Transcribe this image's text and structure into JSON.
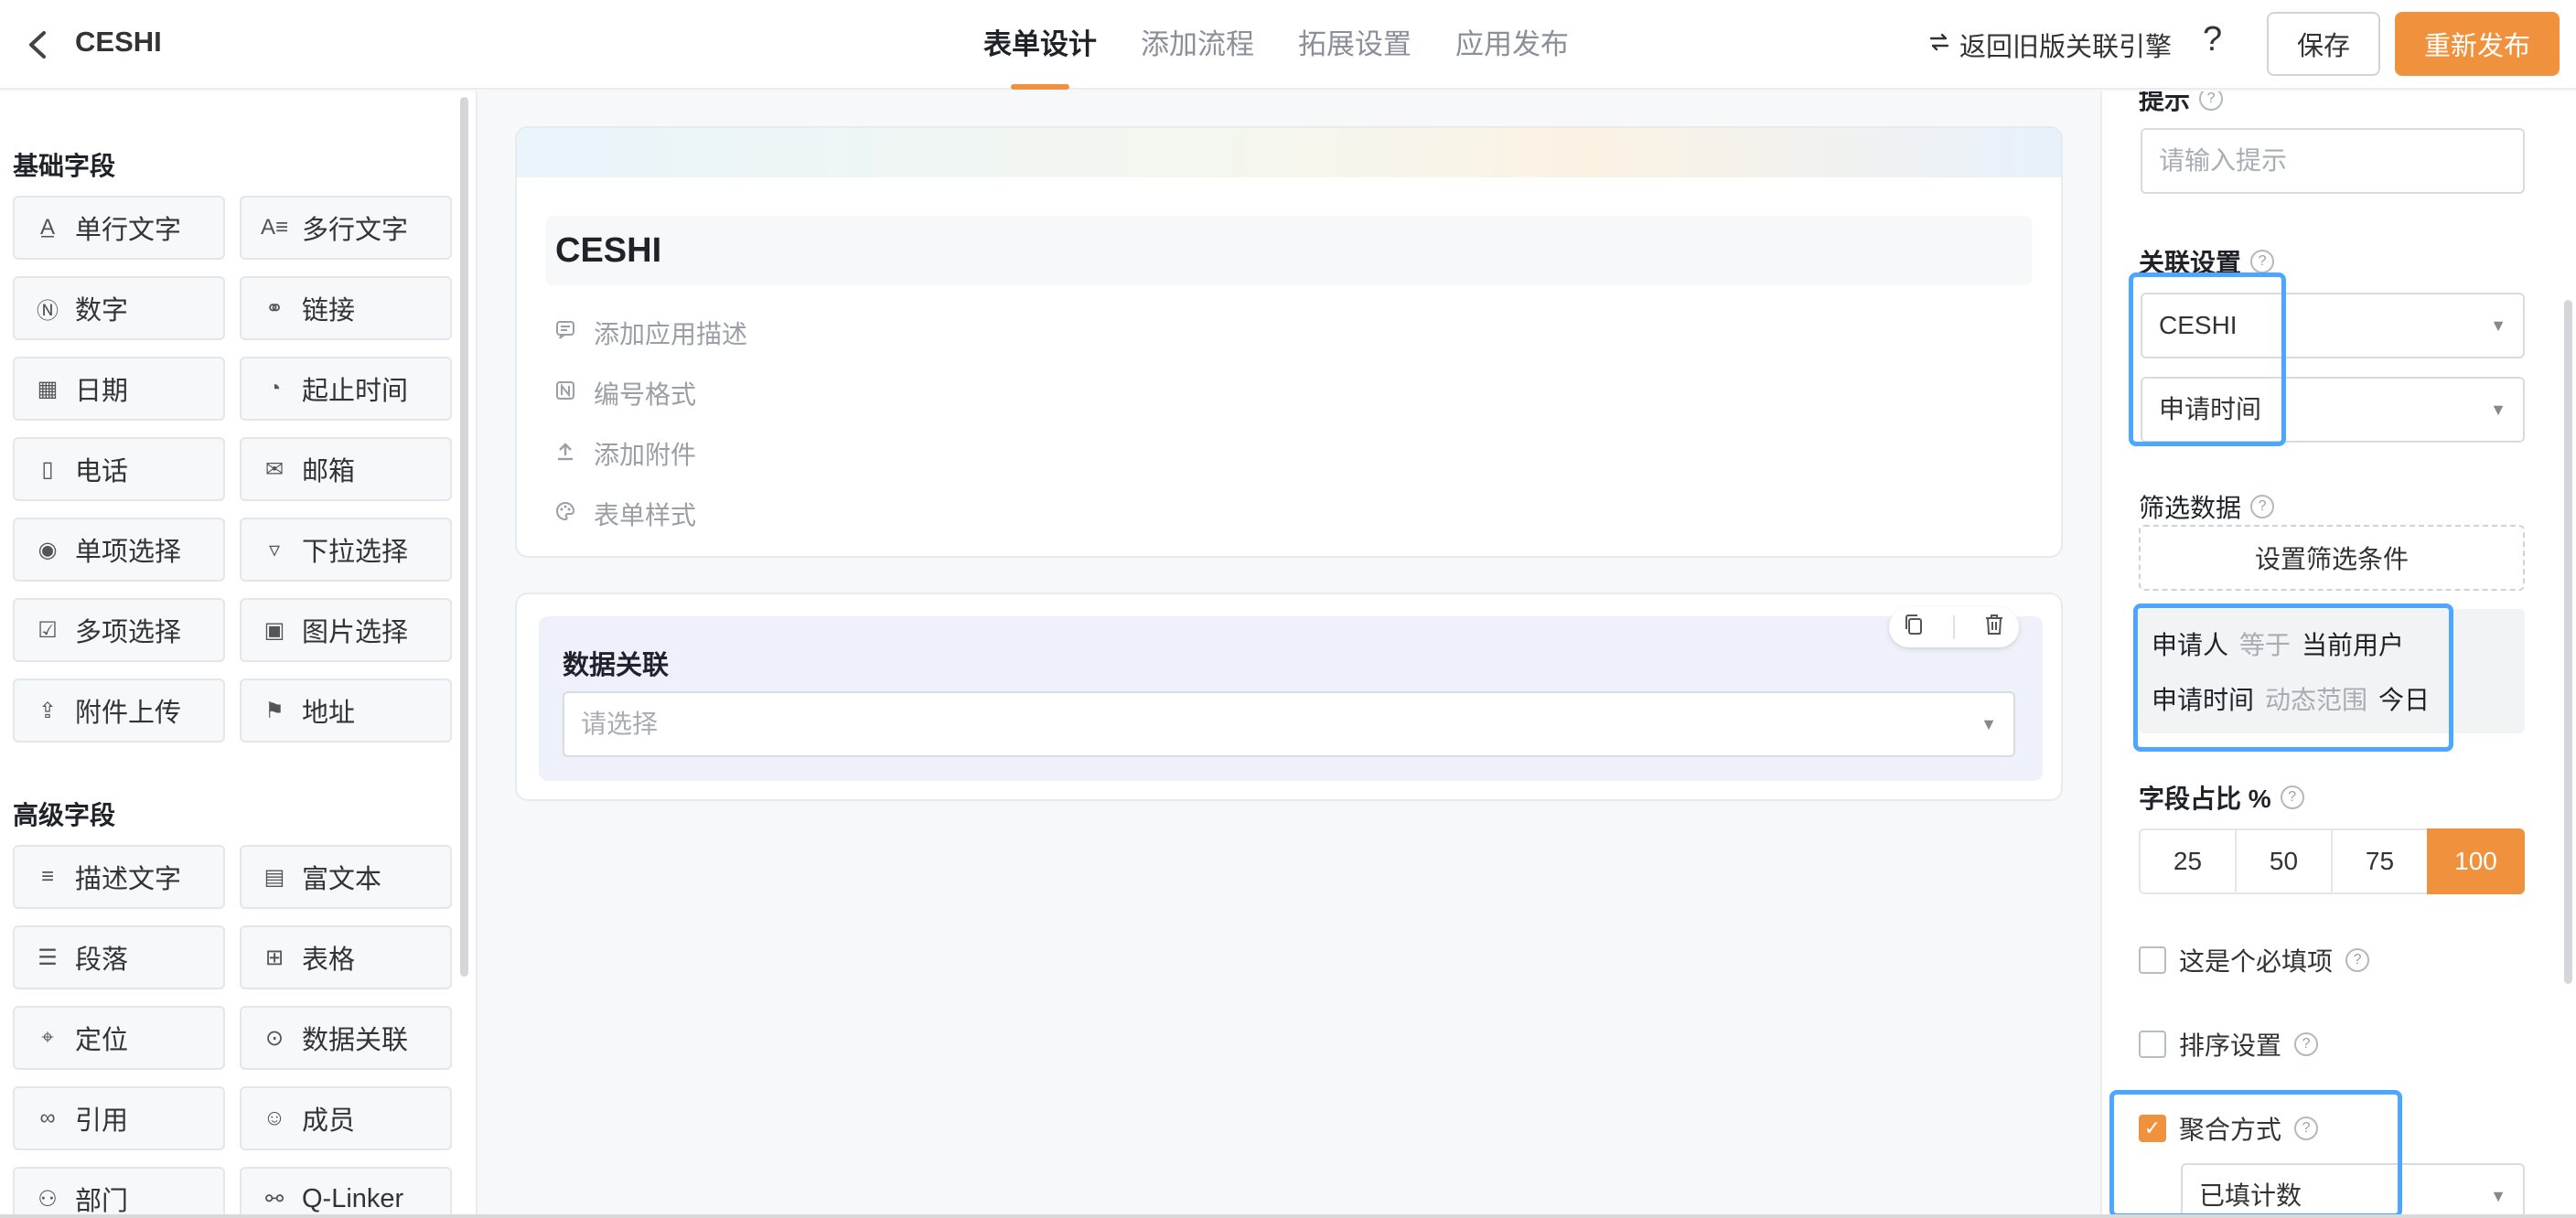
{
  "header": {
    "title": "CESHI",
    "tabs": [
      "表单设计",
      "添加流程",
      "拓展设置",
      "应用发布"
    ],
    "legacy_link": "返回旧版关联引擎",
    "save": "保存",
    "publish": "重新发布",
    "accent": "#f0923d"
  },
  "sidebar": {
    "basic_title": "基础字段",
    "basic": [
      {
        "label": "单行文字",
        "icon": "text-line-icon"
      },
      {
        "label": "多行文字",
        "icon": "text-multiline-icon"
      },
      {
        "label": "数字",
        "icon": "number-icon"
      },
      {
        "label": "链接",
        "icon": "link-icon"
      },
      {
        "label": "日期",
        "icon": "calendar-icon"
      },
      {
        "label": "起止时间",
        "icon": "time-range-icon"
      },
      {
        "label": "电话",
        "icon": "phone-icon"
      },
      {
        "label": "邮箱",
        "icon": "mail-icon"
      },
      {
        "label": "单项选择",
        "icon": "radio-icon"
      },
      {
        "label": "下拉选择",
        "icon": "dropdown-icon"
      },
      {
        "label": "多项选择",
        "icon": "checkbox-icon"
      },
      {
        "label": "图片选择",
        "icon": "image-icon"
      },
      {
        "label": "附件上传",
        "icon": "upload-icon"
      },
      {
        "label": "地址",
        "icon": "signpost-icon"
      }
    ],
    "advanced_title": "高级字段",
    "advanced": [
      {
        "label": "描述文字",
        "icon": "description-icon"
      },
      {
        "label": "富文本",
        "icon": "rich-text-icon"
      },
      {
        "label": "段落",
        "icon": "paragraph-icon"
      },
      {
        "label": "表格",
        "icon": "table-icon"
      },
      {
        "label": "定位",
        "icon": "location-icon"
      },
      {
        "label": "数据关联",
        "icon": "data-link-icon"
      },
      {
        "label": "引用",
        "icon": "reference-icon"
      },
      {
        "label": "成员",
        "icon": "member-icon"
      },
      {
        "label": "部门",
        "icon": "department-icon"
      },
      {
        "label": "Q-Linker",
        "icon": "q-linker-icon"
      }
    ]
  },
  "canvas": {
    "form_title": "CESHI",
    "options": [
      {
        "label": "添加应用描述",
        "icon": "comment-icon"
      },
      {
        "label": "编号格式",
        "icon": "number-format-icon"
      },
      {
        "label": "添加附件",
        "icon": "attach-upload-icon"
      },
      {
        "label": "表单样式",
        "icon": "palette-icon"
      }
    ],
    "field_label": "数据关联",
    "field_placeholder": "请选择"
  },
  "panel": {
    "hint_label": "提示",
    "hint_placeholder": "请输入提示",
    "link_label": "关联设置",
    "link_app": "CESHI",
    "link_field": "申请时间",
    "filter_label": "筛选数据",
    "filter_button": "设置筛选条件",
    "conditions": [
      {
        "field": "申请人",
        "op": "等于",
        "value": "当前用户"
      },
      {
        "field": "申请时间",
        "op": "动态范围",
        "value": "今日"
      }
    ],
    "ratio_label": "字段占比 %",
    "ratios": [
      "25",
      "50",
      "75",
      "100"
    ],
    "ratio_selected": "100",
    "required_label": "这是个必填项",
    "required_checked": false,
    "sort_label": "排序设置",
    "sort_checked": false,
    "agg_label": "聚合方式",
    "agg_checked": true,
    "agg_value": "已填计数"
  }
}
